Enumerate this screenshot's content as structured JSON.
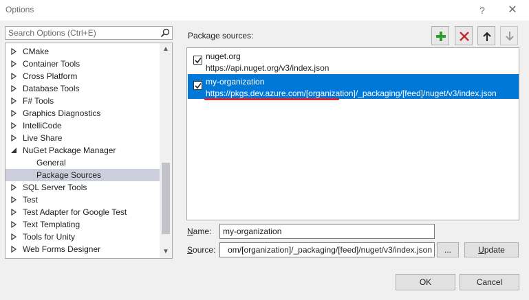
{
  "window": {
    "title": "Options",
    "help": "?",
    "close": "✕"
  },
  "search": {
    "placeholder": "Search Options (Ctrl+E)"
  },
  "tree": {
    "items": [
      {
        "label": "CMake",
        "arrow": "collapsed"
      },
      {
        "label": "Container Tools",
        "arrow": "collapsed"
      },
      {
        "label": "Cross Platform",
        "arrow": "collapsed"
      },
      {
        "label": "Database Tools",
        "arrow": "collapsed"
      },
      {
        "label": "F# Tools",
        "arrow": "collapsed"
      },
      {
        "label": "Graphics Diagnostics",
        "arrow": "collapsed"
      },
      {
        "label": "IntelliCode",
        "arrow": "collapsed"
      },
      {
        "label": "Live Share",
        "arrow": "collapsed"
      },
      {
        "label": "NuGet Package Manager",
        "arrow": "expanded"
      },
      {
        "label": "General",
        "arrow": "none"
      },
      {
        "label": "Package Sources",
        "arrow": "none",
        "selected": true
      },
      {
        "label": "SQL Server Tools",
        "arrow": "collapsed"
      },
      {
        "label": "Test",
        "arrow": "collapsed"
      },
      {
        "label": "Test Adapter for Google Test",
        "arrow": "collapsed"
      },
      {
        "label": "Text Templating",
        "arrow": "collapsed"
      },
      {
        "label": "Tools for Unity",
        "arrow": "collapsed"
      },
      {
        "label": "Web Forms Designer",
        "arrow": "collapsed"
      }
    ]
  },
  "package_sources": {
    "label": "Package sources:",
    "toolbar": {
      "add_icon": "plus-icon",
      "remove_icon": "remove-x-icon",
      "up_icon": "arrow-up-icon",
      "down_icon": "arrow-down-icon"
    },
    "sources": [
      {
        "name": "nuget.org",
        "url": "https://api.nuget.org/v3/index.json",
        "checked": true,
        "selected": false
      },
      {
        "name": "my-organization",
        "url": "https://pkgs.dev.azure.com/[organization]/_packaging/[feed]/nuget/v3/index.json",
        "checked": true,
        "selected": true
      }
    ]
  },
  "form": {
    "name_label_mnemonic": "N",
    "name_label_rest": "ame:",
    "name_value": "my-organization",
    "source_label_mnemonic": "S",
    "source_label_rest": "ource:",
    "source_value_visible": "om/[organization]/_packaging/[feed]/nuget/v3/index.json",
    "browse_label": "...",
    "update_mnemonic": "U",
    "update_rest": "pdate"
  },
  "footer": {
    "ok_label": "OK",
    "cancel_label": "Cancel"
  },
  "colors": {
    "accent": "#0078d7",
    "selection_tree": "#cccedb",
    "add_green": "#2d9e2d",
    "remove_red": "#c4262e",
    "underline_red": "#e5202e"
  }
}
